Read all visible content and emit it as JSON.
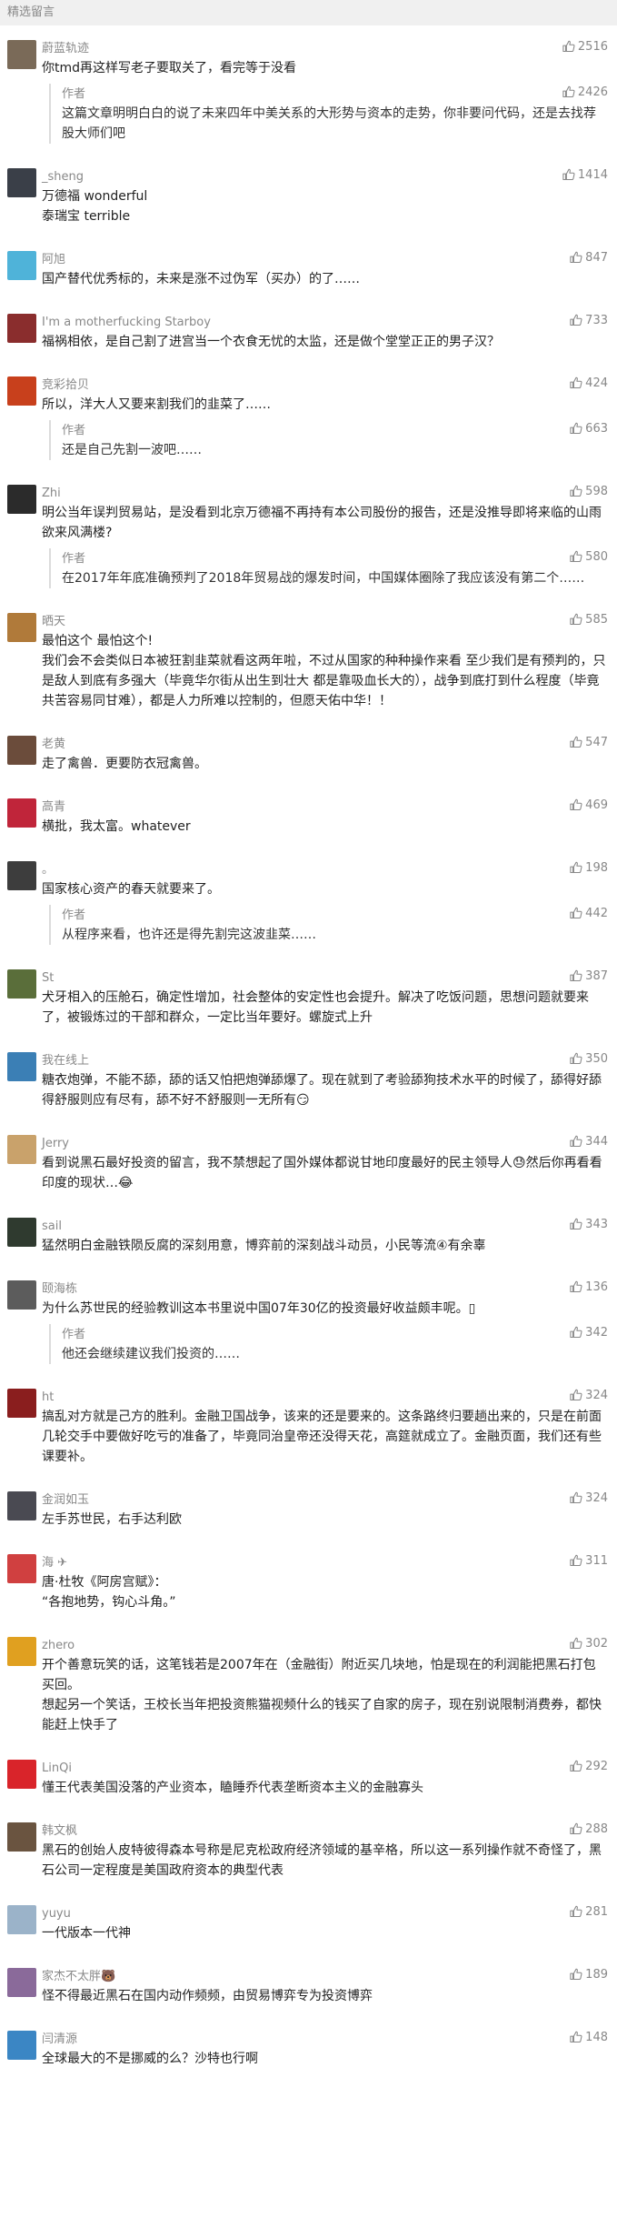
{
  "header": {
    "title": "精选留言"
  },
  "comments": [
    {
      "nick": "蔚蓝轨迹",
      "likes": "2516",
      "avatar_color": "#7a6a58",
      "content": "你tmd再这样写老子要取关了，看完等于没看",
      "reply": {
        "label": "作者",
        "likes": "2426",
        "content": "这篇文章明明白白的说了未来四年中美关系的大形势与资本的走势，你非要问代码，还是去找荐股大师们吧"
      }
    },
    {
      "nick": "_sheng",
      "likes": "1414",
      "avatar_color": "#3a3f48",
      "content": "万德福 wonderful\n泰瑞宝 terrible"
    },
    {
      "nick": "阿旭",
      "likes": "847",
      "avatar_color": "#4fb3d9",
      "content": "国产替代优秀标的，未来是涨不过伪军（买办）的了……"
    },
    {
      "nick": "I'm a motherfucking Starboy",
      "likes": "733",
      "avatar_color": "#8a2d2d",
      "content": "福祸相依，是自己割了进宫当一个衣食无忧的太监，还是做个堂堂正正的男子汉？"
    },
    {
      "nick": "竞彩拾贝",
      "likes": "424",
      "avatar_color": "#c8401c",
      "content": "所以，洋大人又要来割我们的韭菜了……",
      "reply": {
        "label": "作者",
        "likes": "663",
        "content": "还是自己先割一波吧……"
      }
    },
    {
      "nick": "Zhi",
      "likes": "598",
      "avatar_color": "#2b2b2b",
      "content": "明公当年误判贸易站，是没看到北京万德福不再持有本公司股份的报告，还是没推导即将来临的山雨欲来风满楼?",
      "reply": {
        "label": "作者",
        "likes": "580",
        "content": "在2017年年底准确预判了2018年贸易战的爆发时间，中国媒体圈除了我应该没有第二个……"
      }
    },
    {
      "nick": "晒天",
      "likes": "585",
      "avatar_color": "#b07a3a",
      "content": "最怕这个 最怕这个!\n我们会不会类似日本被狂割韭菜就看这两年啦，不过从国家的种种操作来看 至少我们是有预判的，只是敌人到底有多强大（毕竟华尔街从出生到壮大 都是靠吸血长大的），战争到底打到什么程度（毕竟共苦容易同甘难），都是人力所难以控制的，但愿天佑中华！！"
    },
    {
      "nick": "老黄",
      "likes": "547",
      "avatar_color": "#6b4c3b",
      "content": "走了禽兽．更要防衣冠禽兽。"
    },
    {
      "nick": "高青",
      "likes": "469",
      "avatar_color": "#c0253a",
      "content": "横批，我太富。whatever"
    },
    {
      "nick": "。",
      "likes": "198",
      "avatar_color": "#3d3d3d",
      "content": "国家核心资产的春天就要来了。",
      "reply": {
        "label": "作者",
        "likes": "442",
        "content": "从程序来看，也许还是得先割完这波韭菜……"
      }
    },
    {
      "nick": "St",
      "likes": "387",
      "avatar_color": "#5a6e3a",
      "content": "犬牙相入的压舱石，确定性增加，社会整体的安定性也会提升。解决了吃饭问题，思想问题就要来了，被锻炼过的干部和群众，一定比当年要好。螺旋式上升"
    },
    {
      "nick": "我在线上",
      "likes": "350",
      "avatar_color": "#3b7fb5",
      "content": "糖衣炮弹，不能不舔，舔的话又怕把炮弹舔爆了。现在就到了考验舔狗技术水平的时候了，舔得好舔得舒服则应有尽有，舔不好不舒服则一无所有😏"
    },
    {
      "nick": "Jerry",
      "likes": "344",
      "avatar_color": "#c9a26b",
      "content": "看到说黑石最好投资的留言，我不禁想起了国外媒体都说甘地印度最好的民主领导人😓然后你再看看印度的现状…😂"
    },
    {
      "nick": "sail",
      "likes": "343",
      "avatar_color": "#2f3a2f",
      "content": "猛然明白金融铁陨反腐的深刻用意，博弈前的深刻战斗动员，小民等流④有余辜"
    },
    {
      "nick": "颐海栋",
      "likes": "136",
      "avatar_color": "#5c5c5c",
      "content": "为什么苏世民的经验教训这本书里说中国07年30亿的投资最好收益颇丰呢。▯",
      "reply": {
        "label": "作者",
        "likes": "342",
        "content": "他还会继续建议我们投资的……"
      }
    },
    {
      "nick": "ht",
      "likes": "324",
      "avatar_color": "#8a1e1e",
      "content": "搞乱对方就是己方的胜利。金融卫国战争，该来的还是要来的。这条路终归要趟出来的，只是在前面几轮交手中要做好吃亏的准备了，毕竟同治皇帝还没得天花，高筵就成立了。金融页面，我们还有些课要补。"
    },
    {
      "nick": "金润如玉",
      "likes": "324",
      "avatar_color": "#4a4a52",
      "content": "左手苏世民，右手达利欧"
    },
    {
      "nick": "海 ✈",
      "likes": "311",
      "avatar_color": "#d04040",
      "content": "唐·杜牧《阿房宫赋》：\n“各抱地势，钩心斗角。”"
    },
    {
      "nick": "zhero",
      "likes": "302",
      "avatar_color": "#e0a020",
      "content": "开个善意玩笑的话，这笔钱若是2007年在（金融街）附近买几块地，怕是现在的利润能把黑石打包买回。\n想起另一个笑话，王校长当年把投资熊猫视频什么的钱买了自家的房子，现在别说限制消费券，都快能赶上快手了"
    },
    {
      "nick": "LinQi",
      "likes": "292",
      "avatar_color": "#d9242a",
      "content": "懂王代表美国没落的产业资本，瞌睡乔代表垄断资本主义的金融寡头"
    },
    {
      "nick": "韩文枫",
      "likes": "288",
      "avatar_color": "#6a5440",
      "content": "黑石的创始人皮特彼得森本号称是尼克松政府经济领域的基辛格，所以这一系列操作就不奇怪了，黑石公司一定程度是美国政府资本的典型代表"
    },
    {
      "nick": "yuyu",
      "likes": "281",
      "avatar_color": "#9bb3c9",
      "content": "一代版本一代神"
    },
    {
      "nick": "家杰不太胖🐻",
      "likes": "189",
      "avatar_color": "#8a6a9a",
      "content": "怪不得最近黑石在国内动作频频，由贸易博弈专为投资博弈"
    },
    {
      "nick": "闫清源",
      "likes": "148",
      "avatar_color": "#3b86c4",
      "content": "全球最大的不是挪威的么？沙特也行啊"
    }
  ]
}
